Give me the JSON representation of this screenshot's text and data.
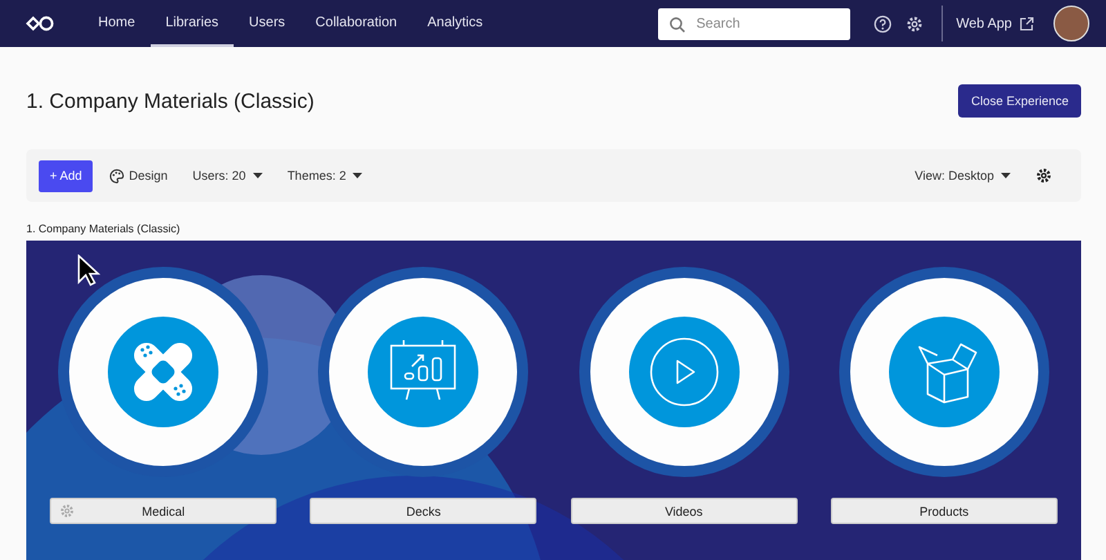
{
  "nav": {
    "items": [
      {
        "label": "Home",
        "selected": false
      },
      {
        "label": "Libraries",
        "selected": true
      },
      {
        "label": "Users",
        "selected": false
      },
      {
        "label": "Collaboration",
        "selected": false
      },
      {
        "label": "Analytics",
        "selected": false
      }
    ],
    "search": {
      "placeholder": "Search"
    },
    "web_app": "Web App"
  },
  "title": "1. Company Materials (Classic)",
  "close_button": "Close Experience",
  "toolbar": {
    "add": "Add",
    "add_icon": "+",
    "design": "Design",
    "users": "Users: 20",
    "themes": "Themes: 2",
    "view": "View: Desktop"
  },
  "caption": "1. Company Materials (Classic)",
  "tiles": [
    {
      "kind": "bandage",
      "label": "Medical",
      "settings": true
    },
    {
      "kind": "chart",
      "label": "Decks",
      "settings": false
    },
    {
      "kind": "play",
      "label": "Videos",
      "settings": false
    },
    {
      "kind": "box",
      "label": "Products",
      "settings": false
    }
  ]
}
